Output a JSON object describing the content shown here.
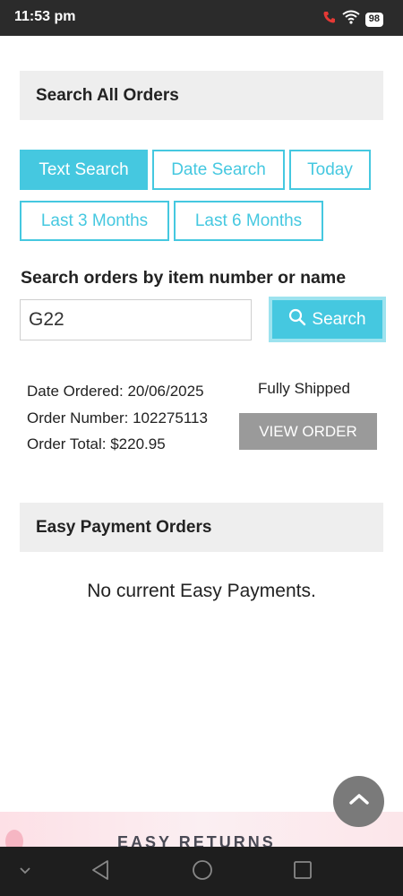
{
  "status_bar": {
    "time": "11:53 pm",
    "battery": "98",
    "icons": [
      "call-icon",
      "wifi-icon",
      "battery-icon"
    ],
    "call_icon_color": "#e53935"
  },
  "search_panel": {
    "title": "Search All Orders",
    "tabs": [
      {
        "label": "Text Search",
        "active": true
      },
      {
        "label": "Date Search",
        "active": false
      },
      {
        "label": "Today",
        "active": false
      },
      {
        "label": "Last 3 Months",
        "active": false
      },
      {
        "label": "Last 6 Months",
        "active": false
      }
    ],
    "search_label": "Search orders by item number or name",
    "search_value": "G22",
    "search_button_label": "Search"
  },
  "order": {
    "date_line": "Date Ordered: 20/06/2025",
    "number_line": "Order Number: 102275113",
    "total_line": "Order Total: $220.95",
    "status": "Fully Shipped",
    "view_button_label": "VIEW ORDER"
  },
  "easy_payment": {
    "title": "Easy Payment Orders",
    "empty_message": "No current Easy Payments."
  },
  "promo_banner": {
    "text": "EASY RETURNS"
  },
  "nav_bar": {
    "icons": [
      "chevron-down-icon",
      "back-icon",
      "home-icon",
      "recents-icon"
    ]
  },
  "colors": {
    "accent": "#45c8e0",
    "view_button": "#9a9a9a",
    "panel_bg": "#eeeeee",
    "status_bar": "#2b2b2b",
    "nav_bar": "#1e1e1e"
  }
}
